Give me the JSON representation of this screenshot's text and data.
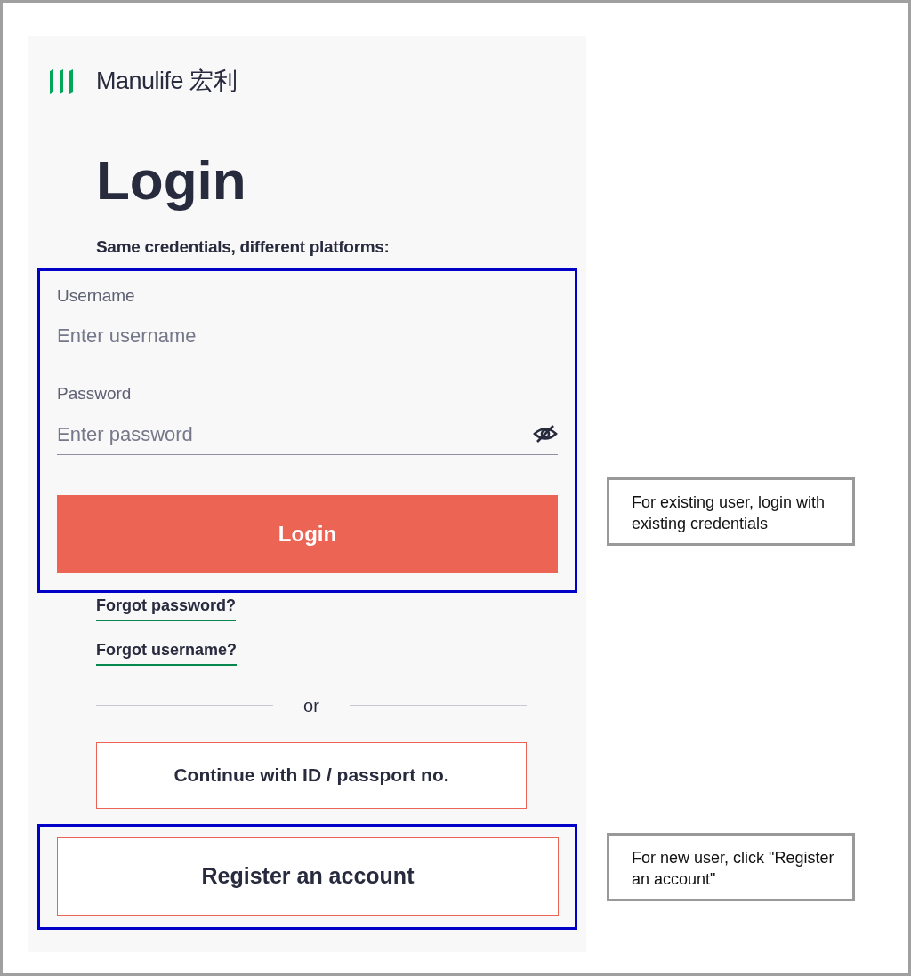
{
  "logo": {
    "text": "Manulife 宏利"
  },
  "title": "Login",
  "subtitle": "Same credentials, different platforms:",
  "fields": [
    {
      "kind": "text",
      "label": "Username",
      "placeholder": "Enter username"
    },
    {
      "kind": "password",
      "label": "Password",
      "placeholder": "Enter password"
    }
  ],
  "login_button": "Login",
  "links": [
    "Forgot password?",
    "Forgot username?"
  ],
  "divider_text": "or",
  "id_button": "Continue with ID / passport no.",
  "register_button": "Register an account",
  "callouts": [
    "For existing user, login with existing credentials",
    "For new user, click \"Register an account\""
  ]
}
